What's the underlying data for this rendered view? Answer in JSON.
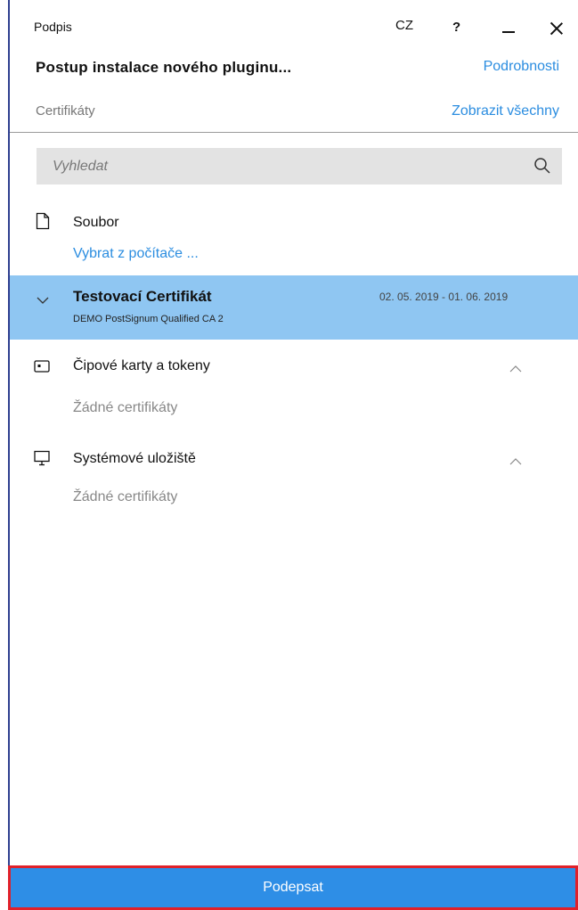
{
  "window": {
    "title": "Podpis",
    "language": "CZ",
    "help": "?"
  },
  "header": {
    "document_title": "Postup instalace nového pluginu...",
    "details_link": "Podrobnosti",
    "section_label": "Certifikáty",
    "show_all_link": "Zobrazit všechny"
  },
  "search": {
    "placeholder": "Vyhledat",
    "value": ""
  },
  "file_section": {
    "title": "Soubor",
    "link": "Vybrat z počítače ..."
  },
  "selected_certificate": {
    "name": "Testovací Certifikát",
    "issuer": "DEMO PostSignum Qualified CA 2",
    "validity": "02. 05. 2019 - 01. 06. 2019"
  },
  "groups": [
    {
      "title": "Čipové karty a tokeny",
      "empty_text": "Žádné certifikáty",
      "icon": "smartcard-icon"
    },
    {
      "title": "Systémové uložiště",
      "empty_text": "Žádné certifikáty",
      "icon": "monitor-icon"
    }
  ],
  "footer": {
    "sign_button": "Podepsat"
  },
  "colors": {
    "accent": "#2b8de0",
    "selected_row": "#8fc6f2",
    "sign_bar": "#2e8ee6",
    "sign_border": "#e0212a"
  }
}
